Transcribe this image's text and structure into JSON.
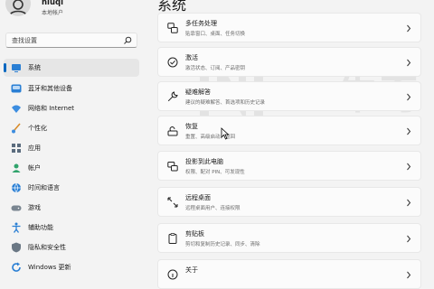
{
  "user": {
    "name": "niuqi",
    "subtitle": "本地帐户"
  },
  "search": {
    "placeholder": "查找设置"
  },
  "page_title": "系统",
  "sidebar": {
    "items": [
      {
        "label": "系统",
        "icon": "monitor-icon",
        "active": true
      },
      {
        "label": "蓝牙和其他设备",
        "icon": "bluetooth-icon"
      },
      {
        "label": "网络和 Internet",
        "icon": "wifi-icon"
      },
      {
        "label": "个性化",
        "icon": "brush-icon"
      },
      {
        "label": "应用",
        "icon": "apps-icon"
      },
      {
        "label": "帐户",
        "icon": "account-icon"
      },
      {
        "label": "时间和语言",
        "icon": "globe-clock-icon"
      },
      {
        "label": "游戏",
        "icon": "gamepad-icon"
      },
      {
        "label": "辅助功能",
        "icon": "accessibility-icon"
      },
      {
        "label": "隐私和安全性",
        "icon": "shield-icon"
      },
      {
        "label": "Windows 更新",
        "icon": "update-icon"
      }
    ]
  },
  "cards": [
    {
      "title": "多任务处理",
      "subtitle": "贴靠窗口、桌面、任务切换",
      "icon": "multitask-icon"
    },
    {
      "title": "激活",
      "subtitle": "激活状态、订阅、产品密钥",
      "icon": "activation-check-icon"
    },
    {
      "title": "疑难解答",
      "subtitle": "建议的疑难解答、首选项和历史记录",
      "icon": "wrench-icon"
    },
    {
      "title": "恢复",
      "subtitle": "重置、高级启动、返回",
      "icon": "recovery-icon"
    },
    {
      "title": "投影到此电脑",
      "subtitle": "权限、配对 PIN、可发现性",
      "icon": "project-icon"
    },
    {
      "title": "远程桌面",
      "subtitle": "远程桌面用户、连接权限",
      "icon": "remote-desktop-icon"
    },
    {
      "title": "剪贴板",
      "subtitle": "剪切和复制历史记录、同步、清除",
      "icon": "clipboard-icon"
    },
    {
      "title": "关于",
      "subtitle": "",
      "icon": "info-icon"
    }
  ],
  "watermark": {
    "text": "NIUQI360",
    "brand": "牛奇"
  },
  "colors": {
    "accent": "#0067c0",
    "background": "#f3f3f3",
    "card": "#fbfbfb"
  }
}
